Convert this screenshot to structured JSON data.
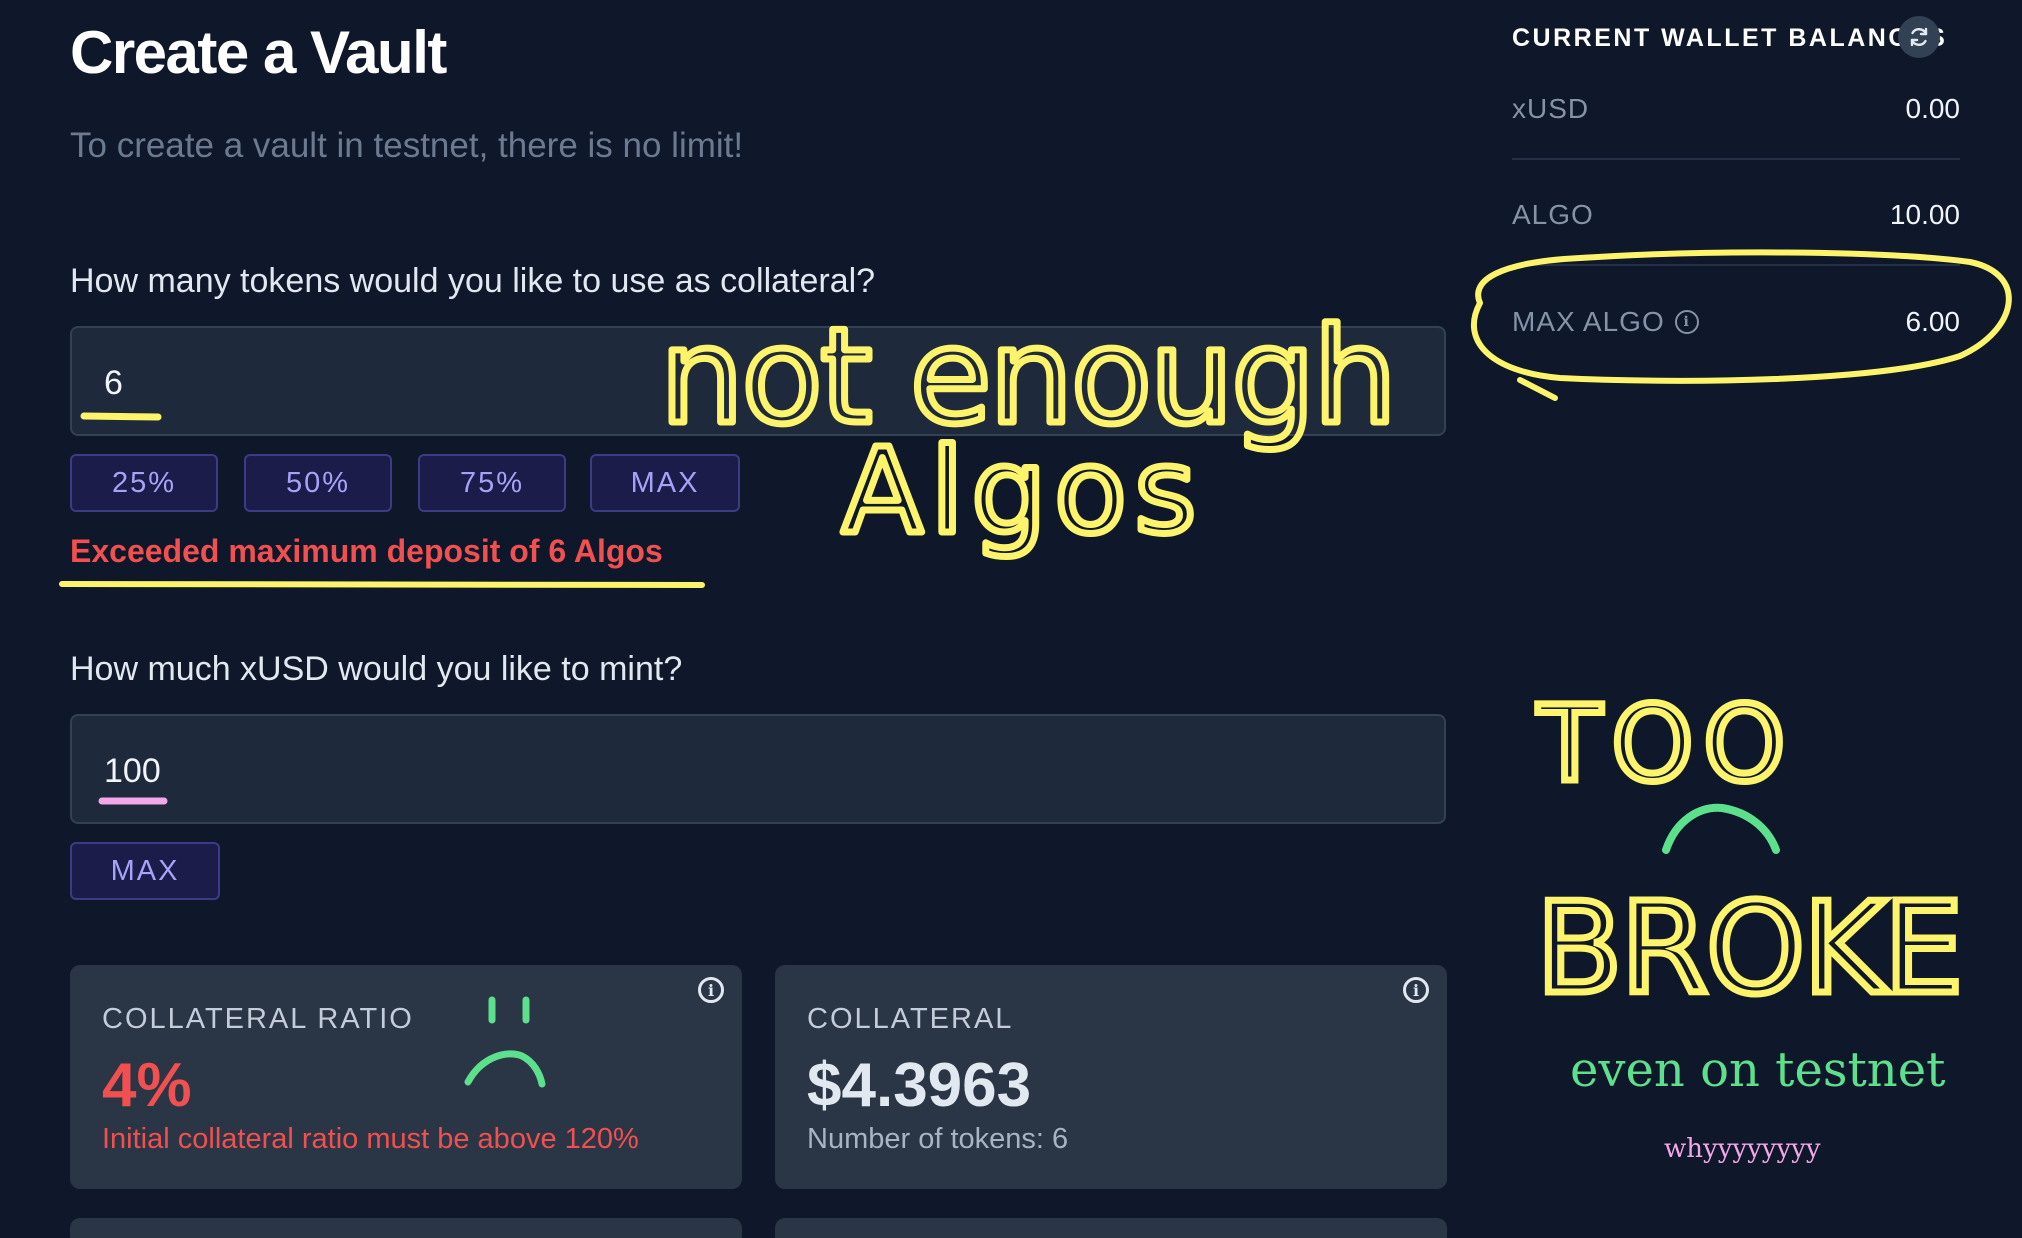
{
  "header": {
    "title": "Create a Vault",
    "subtitle": "To create a vault in testnet, there is no limit!"
  },
  "collateral": {
    "question": "How many tokens would you like to use as collateral?",
    "value": "6",
    "buttons": [
      "25%",
      "50%",
      "75%",
      "MAX"
    ],
    "error": "Exceeded maximum deposit of 6 Algos"
  },
  "mint": {
    "question": "How much xUSD would you like to mint?",
    "value": "100",
    "max_label": "MAX"
  },
  "cards": {
    "ratio": {
      "label": "COLLATERAL RATIO",
      "value": "4%",
      "note": "Initial collateral ratio must be above 120%"
    },
    "collateral": {
      "label": "COLLATERAL",
      "value": "$4.3963",
      "note": "Number of tokens: 6"
    }
  },
  "wallet": {
    "title": "CURRENT WALLET BALANCES",
    "rows": [
      {
        "label": "xUSD",
        "value": "0.00"
      },
      {
        "label": "ALGO",
        "value": "10.00"
      },
      {
        "label": "MAX ALGO",
        "value": "6.00"
      }
    ]
  },
  "annotations": {
    "not_enough_line1": "not enough",
    "not_enough_line2": "Algos",
    "too": "TOO",
    "broke": "BROKE",
    "even_on_testnet": "even on testnet",
    "why": "whyyyyyyyy"
  },
  "colors": {
    "background": "#0f172a",
    "input_bg": "#1e293b",
    "button_bg": "#1c1c4a",
    "button_text": "#a5a3f7",
    "error": "#f0504f",
    "annotation_yellow": "#fdf46b",
    "annotation_green": "#5de08c",
    "annotation_pink": "#f3a6e8"
  },
  "icons": [
    "refresh-icon",
    "info-icon"
  ]
}
